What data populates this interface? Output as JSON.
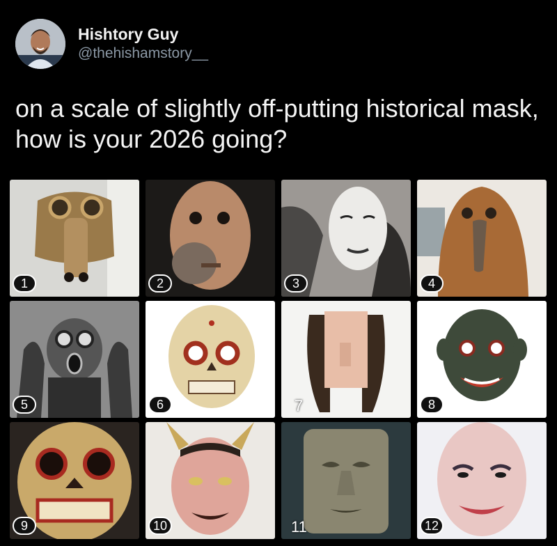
{
  "author": {
    "display_name": "Hishtory Guy",
    "handle": "@thehishamstory__",
    "avatar_icon": "profile-photo"
  },
  "tweet": {
    "text": "on a scale of slightly off-putting historical mask, how is your 2026 going?"
  },
  "masks": [
    {
      "number": "1"
    },
    {
      "number": "2"
    },
    {
      "number": "3"
    },
    {
      "number": "4"
    },
    {
      "number": "5"
    },
    {
      "number": "6"
    },
    {
      "number": "7"
    },
    {
      "number": "8"
    },
    {
      "number": "9"
    },
    {
      "number": "10"
    },
    {
      "number": "11"
    },
    {
      "number": "12"
    }
  ],
  "colors": {
    "background": "#000000",
    "text": "#e7e9ea",
    "handle": "#8b98a5"
  }
}
